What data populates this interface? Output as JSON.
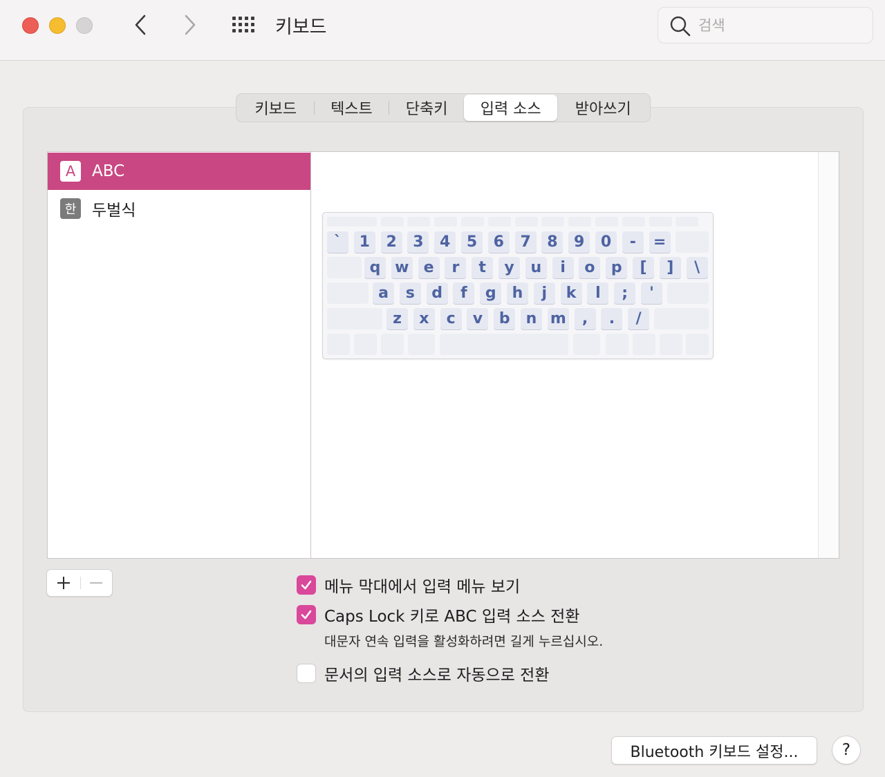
{
  "window": {
    "title": "키보드",
    "search_placeholder": "검색"
  },
  "tabs": [
    {
      "label": "키보드",
      "selected": false
    },
    {
      "label": "텍스트",
      "selected": false
    },
    {
      "label": "단축키",
      "selected": false
    },
    {
      "label": "입력 소스",
      "selected": true
    },
    {
      "label": "받아쓰기",
      "selected": false
    }
  ],
  "sources": [
    {
      "icon_char": "A",
      "label": "ABC",
      "selected": true
    },
    {
      "icon_char": "한",
      "label": "두벌식",
      "selected": false
    }
  ],
  "keyboard": {
    "row1": [
      "`",
      "1",
      "2",
      "3",
      "4",
      "5",
      "6",
      "7",
      "8",
      "9",
      "0",
      "-",
      "="
    ],
    "row2": [
      "q",
      "w",
      "e",
      "r",
      "t",
      "y",
      "u",
      "i",
      "o",
      "p",
      "[",
      "]",
      "\\"
    ],
    "row3": [
      "a",
      "s",
      "d",
      "f",
      "g",
      "h",
      "j",
      "k",
      "l",
      ";",
      "'"
    ],
    "row4": [
      "z",
      "x",
      "c",
      "v",
      "b",
      "n",
      "m",
      ",",
      ".",
      "/"
    ]
  },
  "list_controls": {
    "add": "+",
    "remove": "—"
  },
  "options": [
    {
      "label": "메뉴 막대에서 입력 메뉴 보기",
      "checked": true
    },
    {
      "label": "Caps Lock 키로 ABC 입력 소스 전환",
      "checked": true
    },
    {
      "label": "문서의 입력 소스로 자동으로 전환",
      "checked": false
    }
  ],
  "caps_hint": "대문자 연속 입력을 활성화하려면 길게 누르십시오.",
  "bluetooth_button": "Bluetooth 키보드 설정...",
  "help_button": "?",
  "colors": {
    "accent": "#c94883",
    "checkbox": "#d9489a",
    "key_text": "#4e63a1"
  }
}
